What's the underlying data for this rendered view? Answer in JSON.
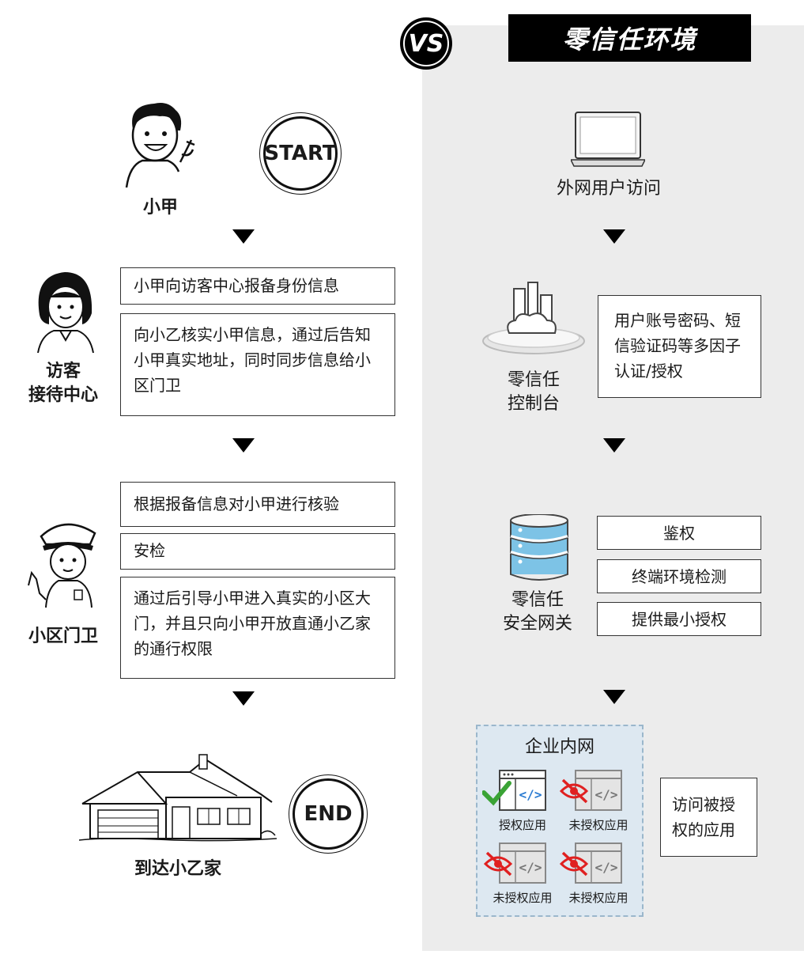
{
  "header": {
    "vs_label": "VS",
    "right_title": "零信任环境"
  },
  "left": {
    "start_label": "START",
    "end_label": "END",
    "actor_xiaojia": "小甲",
    "actor_reception_line1": "访客",
    "actor_reception_line2": "接待中心",
    "actor_guard": "小区门卫",
    "destination": "到达小乙家",
    "step1_box1": "小甲向访客中心报备身份信息",
    "step1_box2": "向小乙核实小甲信息，通过后告知小甲真实地址，同时同步信息给小区门卫",
    "step2_box1": "根据报备信息对小甲进行核验",
    "step2_box2": "安检",
    "step2_box3": "通过后引导小甲进入真实的小区大门，并且只向小甲开放直通小乙家的通行权限"
  },
  "right": {
    "user_access": "外网用户访问",
    "console_line1": "零信任",
    "console_line2": "控制台",
    "console_box": "用户账号密码、短信验证码等多因子认证/授权",
    "gateway_line1": "零信任",
    "gateway_line2": "安全网关",
    "gateway_items": [
      "鉴权",
      "终端环境检测",
      "提供最小授权"
    ],
    "intranet_title": "企业内网",
    "apps": [
      {
        "label": "授权应用",
        "authorized": true
      },
      {
        "label": "未授权应用",
        "authorized": false
      },
      {
        "label": "未授权应用",
        "authorized": false
      },
      {
        "label": "未授权应用",
        "authorized": false
      }
    ],
    "result_box": "访问被授权的应用"
  },
  "colors": {
    "check_green": "#3aa335",
    "deny_red": "#e02020",
    "panel_gray": "#ececec",
    "intranet_blue": "#dde8f1"
  }
}
